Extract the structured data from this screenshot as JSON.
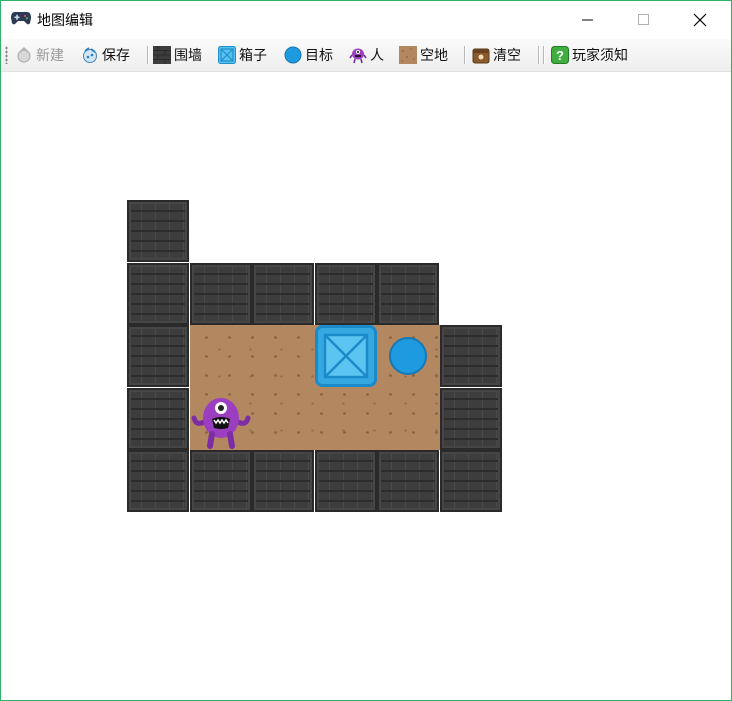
{
  "window": {
    "title": "地图编辑"
  },
  "toolbar": {
    "new_label": "新建",
    "save_label": "保存",
    "wall_label": "围墙",
    "box_label": "箱子",
    "target_label": "目标",
    "person_label": "人",
    "floor_label": "空地",
    "clear_label": "清空",
    "help_label": "玩家须知"
  },
  "colors": {
    "window_border": "#2fb36a",
    "wall": "#3d3d3d",
    "floor": "#b38760",
    "box": "#35a8e0",
    "target": "#1e9be0",
    "player": "#9b3fc0"
  },
  "map": {
    "walls": [
      [
        0,
        0
      ],
      [
        0,
        1
      ],
      [
        1,
        1
      ],
      [
        2,
        1
      ],
      [
        3,
        1
      ],
      [
        4,
        1
      ],
      [
        0,
        2
      ],
      [
        5,
        2
      ],
      [
        0,
        3
      ],
      [
        5,
        3
      ],
      [
        0,
        4
      ],
      [
        1,
        4
      ],
      [
        2,
        4
      ],
      [
        3,
        4
      ],
      [
        4,
        4
      ],
      [
        5,
        4
      ]
    ],
    "floor": [
      [
        1,
        2
      ],
      [
        2,
        2
      ],
      [
        3,
        2
      ],
      [
        4,
        2
      ],
      [
        1,
        3
      ],
      [
        2,
        3
      ],
      [
        3,
        3
      ],
      [
        4,
        3
      ]
    ],
    "boxes": [
      [
        3,
        2
      ]
    ],
    "targets": [
      [
        4,
        2
      ]
    ],
    "player": [
      1,
      3
    ]
  }
}
